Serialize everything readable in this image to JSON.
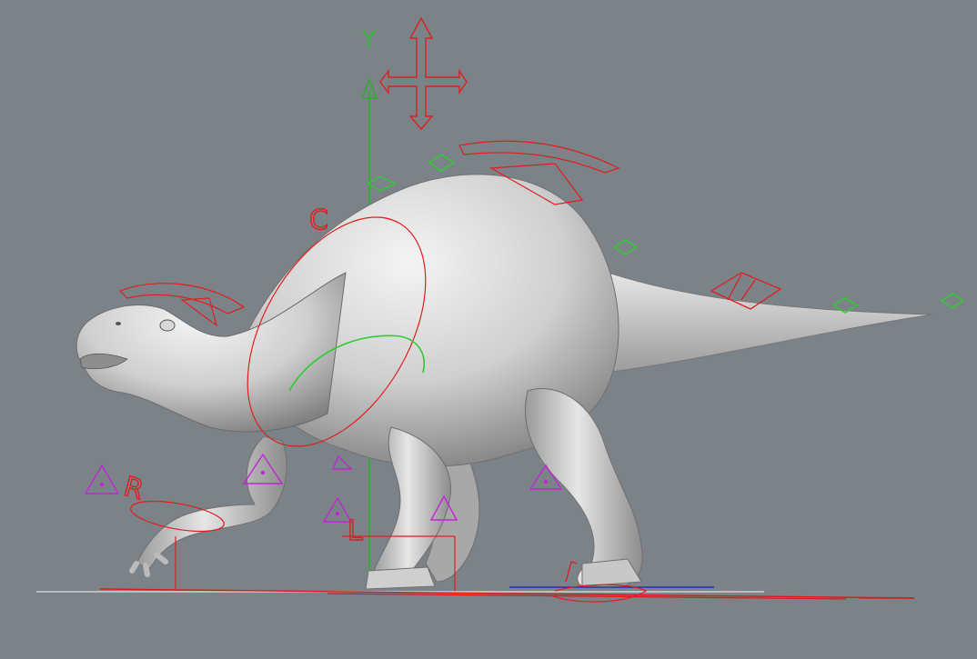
{
  "viewport": {
    "axis_label": "Y",
    "background_color": "#7b8389"
  },
  "rig": {
    "model": "dinosaur",
    "controls": {
      "move_icon": "move-cross-icon",
      "fk_handle_color": "#e01e1e",
      "ik_handle_color": "#2ecc2e",
      "pole_vector_color": "#c026d3"
    },
    "foot_labels": {
      "right": "R",
      "left": "L"
    },
    "head_control_letter": "C"
  }
}
